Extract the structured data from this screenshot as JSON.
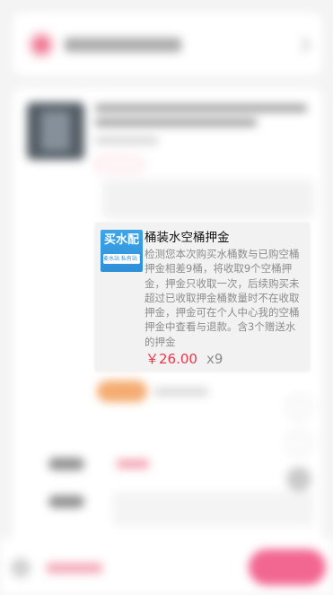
{
  "popup": {
    "thumbnail_title": "买水配",
    "thumbnail_subtitle": "麦水站 私有站 到店自",
    "title": "桶装水空桶押金",
    "description": "检测您本次购买水桶数与已购空桶押金相差9桶，将收取9个空桶押金，押金只收取一次，后续购买未超过已收取押金桶数量时不在收取押金，押金可在个人中心我的空桶押金中查看与退款。含3个赠送水的押金",
    "price": "￥26.00",
    "quantity": "x9"
  },
  "colors": {
    "price_red": "#e8384f",
    "thumbnail_blue": "#2f8fd8",
    "muted_text": "#8c8c8c"
  },
  "icons": {
    "header_logo": "store-logo-icon",
    "header_chevron": "chevron-right-icon"
  }
}
